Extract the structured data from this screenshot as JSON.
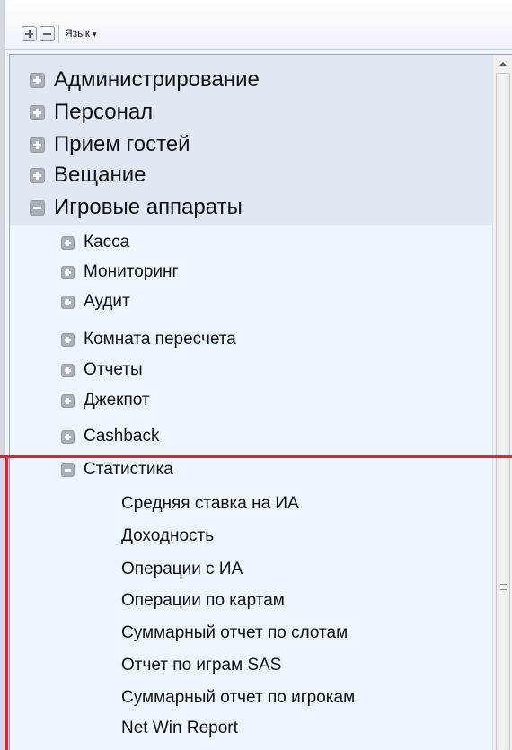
{
  "toolbar": {
    "expand_icon": "plus-square-icon",
    "collapse_icon": "minus-square-icon",
    "language_label": "Язык",
    "language_caret": "▾"
  },
  "tree": {
    "top_level": [
      {
        "label": "Администрирование",
        "state": "collapsed"
      },
      {
        "label": "Персонал",
        "state": "collapsed"
      },
      {
        "label": "Прием гостей",
        "state": "collapsed"
      },
      {
        "label": "Вещание",
        "state": "collapsed"
      },
      {
        "label": "Игровые аппараты",
        "state": "expanded"
      }
    ],
    "children": [
      {
        "label": "Касса",
        "state": "collapsed"
      },
      {
        "label": "Мониторинг",
        "state": "collapsed"
      },
      {
        "label": "Аудит",
        "state": "collapsed"
      },
      {
        "label": "Комната пересчета",
        "state": "collapsed"
      },
      {
        "label": "Отчеты",
        "state": "collapsed"
      },
      {
        "label": "Джекпот",
        "state": "collapsed"
      },
      {
        "label": "Cashback",
        "state": "collapsed"
      },
      {
        "label": "Статистика",
        "state": "expanded"
      }
    ],
    "stats_items": [
      "Средняя ставка на ИА",
      "Доходность",
      "Операции с ИА",
      "Операции по картам",
      "Суммарный отчет по слотам",
      "Отчет по играм SAS",
      "Суммарный отчет по игрокам",
      "Net Win Report"
    ]
  },
  "colors": {
    "highlight": "#e0232e",
    "panel_bg": "#edf5fd",
    "top_band_bg": "#e0e9f3"
  }
}
